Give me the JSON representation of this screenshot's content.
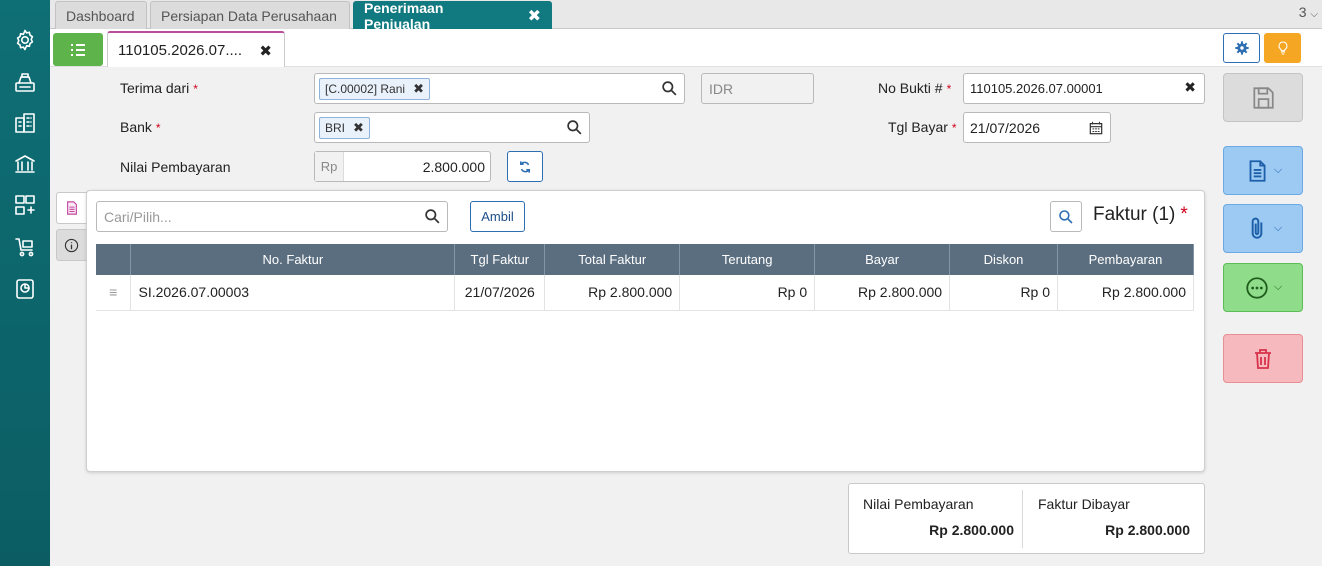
{
  "tabs": {
    "dashboard": "Dashboard",
    "persiapan": "Persiapan Data Perusahaan",
    "penerimaan": "Penerimaan Penjualan",
    "count": "3"
  },
  "doc_tab": {
    "label": "110105.2026.07...."
  },
  "form": {
    "terima_label": "Terima dari",
    "terima_chip": "[C.00002] Rani",
    "currency": "IDR",
    "bank_label": "Bank",
    "bank_chip": "BRI",
    "nilai_label": "Nilai Pembayaran",
    "nilai_prefix": "Rp",
    "nilai_value": "2.800.000",
    "nobukti_label": "No Bukti #",
    "nobukti_value": "110105.2026.07.00001",
    "tgl_label": "Tgl Bayar",
    "tgl_value": "21/07/2026",
    "required_mark": "*"
  },
  "panel": {
    "search_placeholder": "Cari/Pilih...",
    "ambil_label": "Ambil",
    "faktur_title": "Faktur (1)",
    "required_mark": "*",
    "columns": [
      "No. Faktur",
      "Tgl Faktur",
      "Total Faktur",
      "Terutang",
      "Bayar",
      "Diskon",
      "Pembayaran"
    ],
    "rows": [
      {
        "no_faktur": "SI.2026.07.00003",
        "tgl_faktur": "21/07/2026",
        "total": "Rp 2.800.000",
        "terutang": "Rp 0",
        "bayar": "Rp 2.800.000",
        "diskon": "Rp 0",
        "pembayaran": "Rp 2.800.000"
      }
    ]
  },
  "summary": {
    "nilai_label": "Nilai Pembayaran",
    "nilai_value": "Rp 2.800.000",
    "faktur_label": "Faktur Dibayar",
    "faktur_value": "Rp 2.800.000"
  },
  "colors": {
    "sidebar": "#0e6f75",
    "active_tab": "#117a80",
    "green": "#5fb34b",
    "table_header": "#5b6e80",
    "accent_blue": "#2e6eb3"
  }
}
